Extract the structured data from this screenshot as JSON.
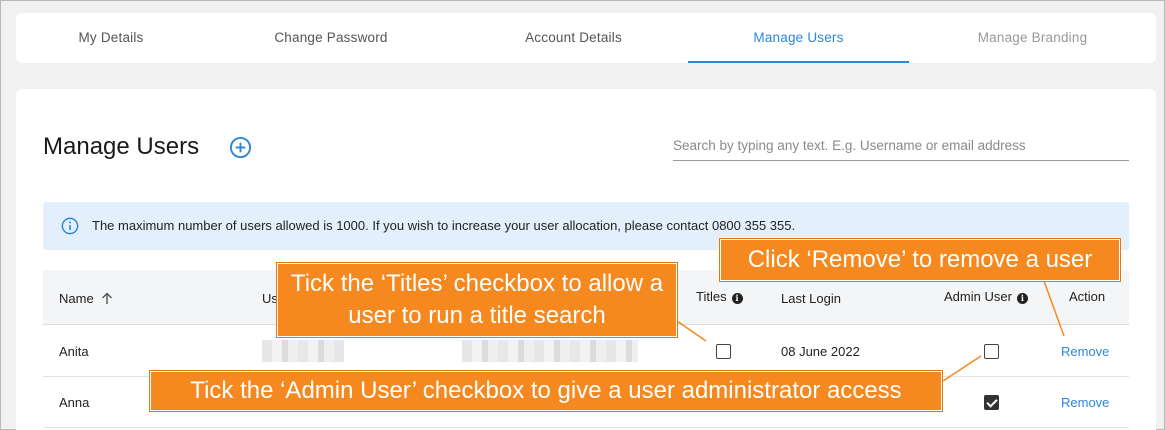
{
  "tabs": [
    {
      "label": "My Details",
      "state": "normal"
    },
    {
      "label": "Change Password",
      "state": "normal"
    },
    {
      "label": "Account Details",
      "state": "normal"
    },
    {
      "label": "Manage Users",
      "state": "active"
    },
    {
      "label": "Manage Branding",
      "state": "disabled"
    }
  ],
  "page": {
    "title": "Manage Users",
    "add_icon": "plus-circle-icon",
    "search_placeholder": "Search by typing any text. E.g. Username or email address",
    "search_value": ""
  },
  "info": {
    "icon": "info-icon",
    "text": "The maximum number of users allowed is 1000. If you wish to increase your user allocation, please contact 0800 355 355."
  },
  "table": {
    "headers": {
      "name": "Name",
      "username": "Us",
      "titles": "Titles",
      "last_login": "Last Login",
      "admin_user": "Admin User",
      "action": "Action"
    },
    "rows": [
      {
        "name": "Anita",
        "last_login": "08 June 2022",
        "titles_checked": false,
        "admin_checked": false,
        "action": "Remove"
      },
      {
        "name": "Anna",
        "last_login": "",
        "titles_checked": false,
        "admin_checked": true,
        "action": "Remove"
      }
    ]
  },
  "callouts": {
    "titles": "Tick the ‘Titles’ checkbox to allow a user to run a title search",
    "remove": "Click ‘Remove’ to remove a user",
    "admin": "Tick the ‘Admin User’ checkbox to give a user administrator access"
  },
  "colors": {
    "accent": "#2b87da",
    "callout": "#f5881f",
    "info_bg": "#e3f0fb"
  }
}
